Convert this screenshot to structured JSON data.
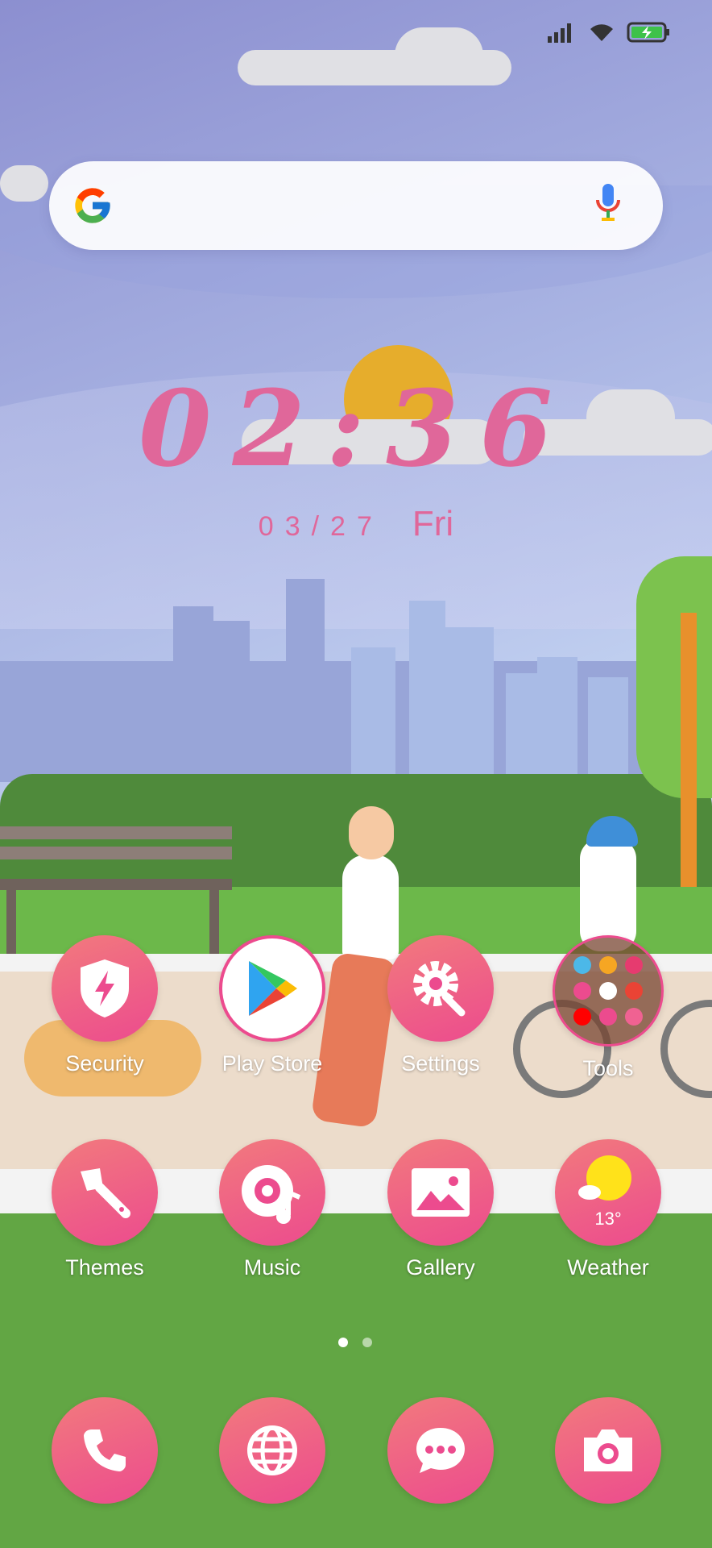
{
  "status_bar": {
    "signal_icon": "cellular-signal-icon",
    "wifi_icon": "wifi-icon",
    "battery_icon": "battery-charging-icon"
  },
  "search": {
    "logo": "google-g-logo",
    "mic_icon": "microphone-icon"
  },
  "clock": {
    "time": "02:36",
    "date": "03/27",
    "weekday": "Fri"
  },
  "apps_row1": [
    {
      "label": "Security",
      "icon": "shield-bolt-icon"
    },
    {
      "label": "Play Store",
      "icon": "play-store-icon"
    },
    {
      "label": "Settings",
      "icon": "gear-wrench-icon"
    },
    {
      "label": "Tools",
      "icon": "folder-icon"
    }
  ],
  "apps_row2": [
    {
      "label": "Themes",
      "icon": "paintbrush-icon"
    },
    {
      "label": "Music",
      "icon": "music-disc-icon"
    },
    {
      "label": "Gallery",
      "icon": "image-icon"
    },
    {
      "label": "Weather",
      "icon": "sun-cloud-icon",
      "temperature": "13°"
    }
  ],
  "page_indicator": {
    "pages": 2,
    "current": 1
  },
  "dock": [
    {
      "icon": "phone-icon"
    },
    {
      "icon": "globe-icon"
    },
    {
      "icon": "chat-bubble-icon"
    },
    {
      "icon": "camera-icon"
    }
  ],
  "colors": {
    "accent_pink": "#ec4b8e",
    "clock_pink": "#e0679a"
  }
}
